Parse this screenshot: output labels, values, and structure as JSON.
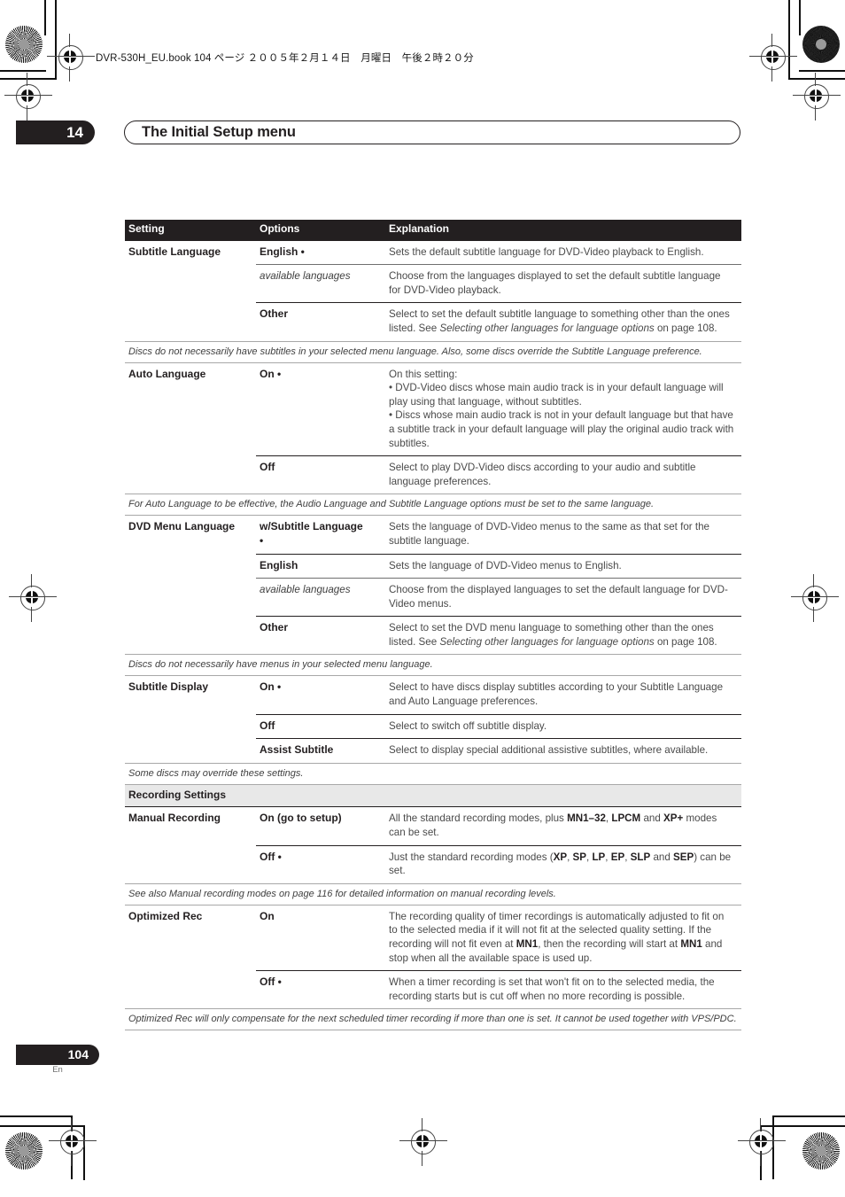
{
  "slug": "DVR-530H_EU.book  104 ページ  ２００５年２月１４日　月曜日　午後２時２０分",
  "chapter": {
    "number": "14",
    "title": "The Initial Setup menu"
  },
  "table": {
    "headers": {
      "setting": "Setting",
      "options": "Options",
      "explanation": "Explanation"
    },
    "rows": [
      {
        "type": "row",
        "rule": "heavy",
        "setting": "Subtitle Language",
        "options": "English •",
        "options_style": "bold",
        "explanation": "Sets the default subtitle language for DVD-Video playback to English."
      },
      {
        "type": "row",
        "rule": "light",
        "setting": "",
        "options": "available languages",
        "options_style": "italic",
        "explanation": "Choose from the languages displayed to set the default subtitle language for DVD-Video playback."
      },
      {
        "type": "row",
        "rule": "heavy-opt",
        "setting": "",
        "options": "Other",
        "options_style": "bold",
        "explanation": "Select to set the default subtitle language to something other than the ones listed. See Selecting other languages for language options on page 108.",
        "explanation_italic_part": "Selecting other languages for language options"
      },
      {
        "type": "note",
        "text": "Discs do not necessarily have subtitles in your selected menu language. Also, some discs override the Subtitle Language preference."
      },
      {
        "type": "row",
        "rule": "none",
        "setting": "Auto Language",
        "options": "On •",
        "options_style": "bold",
        "explanation": "On this setting:\n• DVD-Video discs whose main audio track is in your default language will play using that language, without subtitles.\n• Discs whose main audio track is not in your default language but that have a subtitle track in your default language will play the original audio track with subtitles."
      },
      {
        "type": "row",
        "rule": "heavy-opt",
        "setting": "",
        "options": "Off",
        "options_style": "bold",
        "explanation": "Select to play DVD-Video discs according to your audio and subtitle language preferences."
      },
      {
        "type": "note",
        "text": "For Auto Language to be effective, the Audio Language and Subtitle Language options must be set to the same language."
      },
      {
        "type": "row",
        "rule": "none",
        "setting": "DVD Menu Language",
        "options": "w/Subtitle Language\n•",
        "options_style": "bold",
        "explanation": "Sets the language of DVD-Video menus to the same as that set for the subtitle language."
      },
      {
        "type": "row",
        "rule": "heavy-opt",
        "setting": "",
        "options": "English",
        "options_style": "bold",
        "explanation": "Sets the language of DVD-Video menus to English."
      },
      {
        "type": "row",
        "rule": "light",
        "setting": "",
        "options": "available languages",
        "options_style": "italic",
        "explanation": "Choose from the displayed languages to set the default language for DVD-Video menus."
      },
      {
        "type": "row",
        "rule": "heavy-opt",
        "setting": "",
        "options": "Other",
        "options_style": "bold",
        "explanation": "Select to set the DVD menu language to something other than the ones listed. See Selecting other languages for language options on page 108.",
        "explanation_italic_part": "Selecting other languages for language options"
      },
      {
        "type": "note",
        "text": "Discs do not necessarily have menus in your selected menu language."
      },
      {
        "type": "row",
        "rule": "none",
        "setting": "Subtitle Display",
        "options": "On •",
        "options_style": "bold",
        "explanation": "Select to have discs display subtitles according to your Subtitle Language and Auto Language preferences."
      },
      {
        "type": "row",
        "rule": "heavy-opt",
        "setting": "",
        "options": "Off",
        "options_style": "bold",
        "explanation": "Select to switch off subtitle display."
      },
      {
        "type": "row",
        "rule": "heavy-opt",
        "setting": "",
        "options": "Assist Subtitle",
        "options_style": "bold",
        "explanation": "Select to display special additional assistive subtitles, where available."
      },
      {
        "type": "note",
        "text": "Some discs may override these settings."
      },
      {
        "type": "band",
        "text": "Recording Settings"
      },
      {
        "type": "row",
        "rule": "heavy",
        "setting": "Manual Recording",
        "options": "On (go to setup)",
        "options_style": "bold",
        "explanation": "All the standard recording modes, plus MN1–32, LPCM and XP+ modes can be set."
      },
      {
        "type": "row",
        "rule": "heavy-opt",
        "setting": "",
        "options": "Off •",
        "options_style": "bold",
        "explanation": "Just the standard recording modes (XP, SP, LP, EP, SLP and SEP) can be set."
      },
      {
        "type": "note",
        "text": "See also Manual recording modes on page 116 for detailed information on manual recording levels."
      },
      {
        "type": "row",
        "rule": "none",
        "setting": "Optimized Rec",
        "options": "On",
        "options_style": "bold",
        "explanation": "The recording quality of timer recordings is automatically adjusted to fit on to the selected media if it will not fit at the selected quality setting. If the recording will not fit even at MN1, then the recording will start at MN1 and stop when all the available space is used up."
      },
      {
        "type": "row",
        "rule": "heavy-opt",
        "setting": "",
        "options": "Off •",
        "options_style": "bold",
        "explanation": "When a timer recording is set that won't fit on to the selected media, the recording starts but is cut off when no more recording is possible."
      },
      {
        "type": "note",
        "text": "Optimized Rec will only compensate for the next scheduled timer recording if more than one is set. It cannot be used together with VPS/PDC."
      }
    ]
  },
  "footer": {
    "page_number": "104",
    "language_code": "En"
  }
}
